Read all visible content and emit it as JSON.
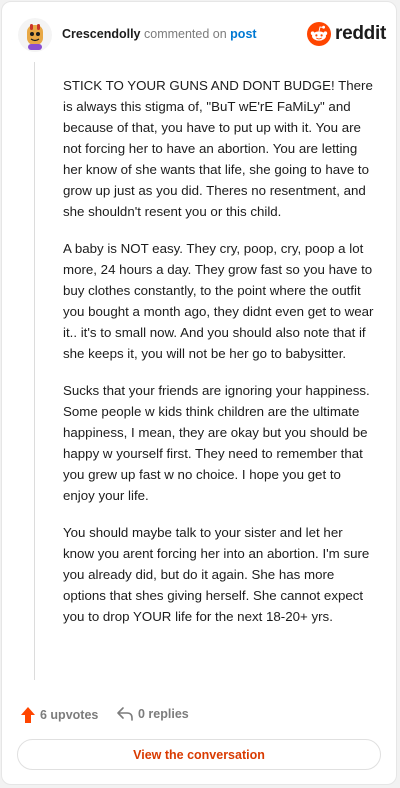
{
  "header": {
    "username": "Crescendolly",
    "action_text": "commented on",
    "post_link": "post",
    "brand": "reddit"
  },
  "comment": {
    "paragraphs": [
      "STICK TO YOUR GUNS AND DONT BUDGE! There is always this stigma of, \"BuT wE'rE FaMiLy\" and because of that, you have to put up with it. You are not forcing her to have an abortion. You are letting her know of she wants that life, she going to have to grow up just as you did. Theres no resentment, and she shouldn't resent you or this child.",
      "A baby is NOT easy. They cry, poop, cry, poop a lot more, 24 hours a day. They grow fast so you have to buy clothes constantly, to the point where the outfit you bought a month ago, they didnt even get to wear it.. it's to small now. And you should also note that if she keeps it, you will not be her go to babysitter.",
      "Sucks that your friends are ignoring your happiness. Some people w kids think children are the ultimate happiness, I mean, they are okay but you should be happy w yourself first. They need to remember that you grew up fast w no choice. I hope you get to enjoy your life.",
      "You should maybe talk to your sister and let her know you arent forcing her into an abortion. I'm sure you already did, but do it again. She has more options that shes giving herself. She cannot expect you to drop YOUR life for the next 18-20+ yrs."
    ]
  },
  "footer": {
    "upvotes": "6 upvotes",
    "replies": "0 replies",
    "view_button": "View the conversation"
  },
  "icons": {
    "avatar": "snoo-avatar-icon",
    "brand": "reddit-logo-icon",
    "upvote": "upvote-arrow-icon",
    "reply": "reply-arrow-icon"
  },
  "colors": {
    "accent": "#ff4500",
    "link": "#0079d3",
    "button_text": "#d93a00"
  }
}
